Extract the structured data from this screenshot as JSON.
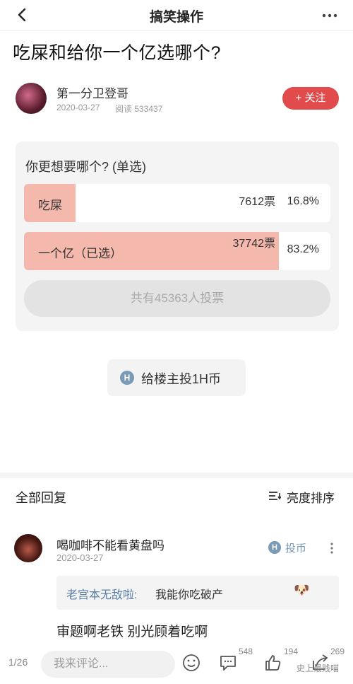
{
  "header": {
    "title": "搞笑操作"
  },
  "post": {
    "title": "吃屎和给你一个亿选哪个?",
    "author": "第一分卫登哥",
    "date": "2020-03-27",
    "reads": "阅读 533437",
    "follow_label": "+ 关注"
  },
  "poll": {
    "question": "你更想要哪个? (单选)",
    "options": [
      {
        "label": "吃屎",
        "votes": "7612票",
        "percent": "16.8%",
        "fill_fraction": 0.168
      },
      {
        "label": "一个亿（已选）",
        "votes": "37742票",
        "percent": "83.2%",
        "fill_fraction": 0.832
      }
    ],
    "total_label": "共有45363人投票"
  },
  "coin": {
    "icon": "H",
    "label": "给楼主投1H币"
  },
  "replies": {
    "title": "全部回复",
    "sort_label": "亮度排序",
    "comment": {
      "text": "喝咖啡不能看黄盘吗",
      "date": "2020-03-27",
      "coin_label": "投币",
      "coin_icon": "H",
      "quote_user": "老宫本无敌啦:",
      "quote_text": "我能你吃破产",
      "quote_emoji": "🐶",
      "reply": "审题啊老铁  别光顾着吃啊"
    }
  },
  "bottom": {
    "page": "1/26",
    "placeholder": "我来评论...",
    "comments_count": "548",
    "likes_count": "194",
    "shares_count": "269",
    "watermark": "史上最贱喵"
  },
  "colors": {
    "accent": "#e24b4b",
    "poll_fill": "#f4b8ad",
    "link": "#5a7fa8"
  }
}
